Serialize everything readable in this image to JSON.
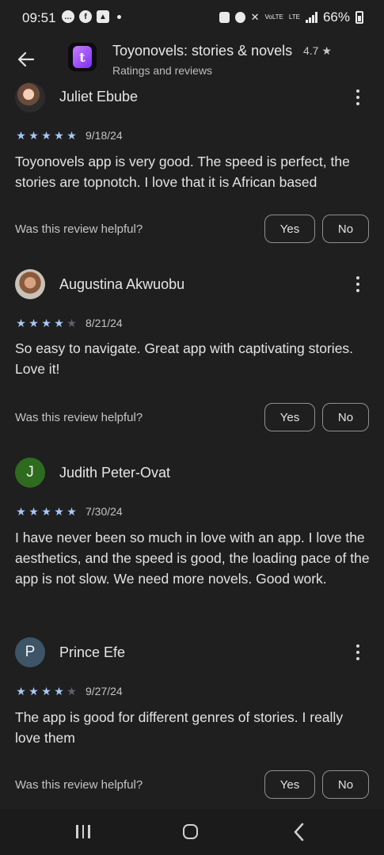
{
  "status_bar": {
    "time": "09:51",
    "battery": "66%",
    "net_top": "VoLTE",
    "net_bottom": "LTE"
  },
  "app_bar": {
    "title": "Toyonovels: stories & novels",
    "rating": "4.7 ★",
    "subtitle": "Ratings and reviews",
    "app_icon_letter": "t"
  },
  "helpful_prompt": "Was this review helpful?",
  "yes_label": "Yes",
  "no_label": "No",
  "reviews": [
    {
      "name": "Juliet Ebube",
      "avatar": "photo",
      "stars": 5,
      "date": "9/18/24",
      "text": "Toyonovels app is very good. The speed is perfect, the stories are topnotch. I love that it is African based"
    },
    {
      "name": "Augustina Akwuobu",
      "avatar": "photo",
      "stars": 4,
      "date": "8/21/24",
      "text": "So easy to navigate. Great app with captivating stories. Love it!"
    },
    {
      "name": "Judith Peter-Ovat",
      "avatar_letter": "J",
      "avatar_color": "#2e6b1f",
      "stars": 5,
      "date": "7/30/24",
      "text": "I have never been so much in love with an app. I love the aesthetics, and the speed is good, the loading pace of the app is not slow. We need more novels. Good work."
    },
    {
      "name": "Prince Efe",
      "avatar_letter": "P",
      "avatar_color": "#3d5566",
      "stars": 4,
      "date": "9/27/24",
      "text": "The app is good for different genres of stories. I really love them"
    }
  ],
  "colors": {
    "background": "#1f1f1f",
    "star_on": "#a8c7fa",
    "star_off": "#5f6368"
  }
}
